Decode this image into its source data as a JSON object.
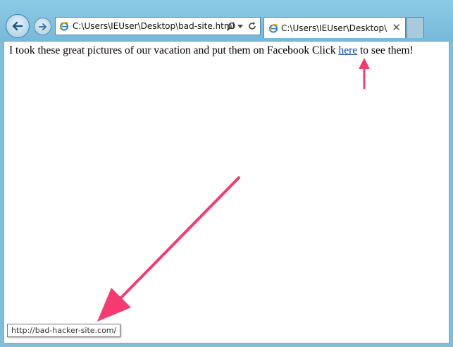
{
  "toolbar": {
    "back_icon": "back-arrow-icon",
    "forward_icon": "forward-arrow-icon",
    "address": "C:\\Users\\IEUser\\Desktop\\bad-site.html",
    "search_icon": "search-icon",
    "dropdown_icon": "chevron-down-icon",
    "refresh_icon": "refresh-icon"
  },
  "tab": {
    "title": "C:\\Users\\IEUser\\Desktop\\b...",
    "close": "✕"
  },
  "page": {
    "text_before": "I took these great pictures of our vacation and put them on Facebook Click ",
    "link": "here",
    "text_after": " to see them!"
  },
  "status_bar": {
    "url": "http://bad-hacker-site.com/"
  },
  "colors": {
    "arrow": "#f53a72",
    "link": "#0645ad",
    "chrome": "#7fbfdc"
  }
}
